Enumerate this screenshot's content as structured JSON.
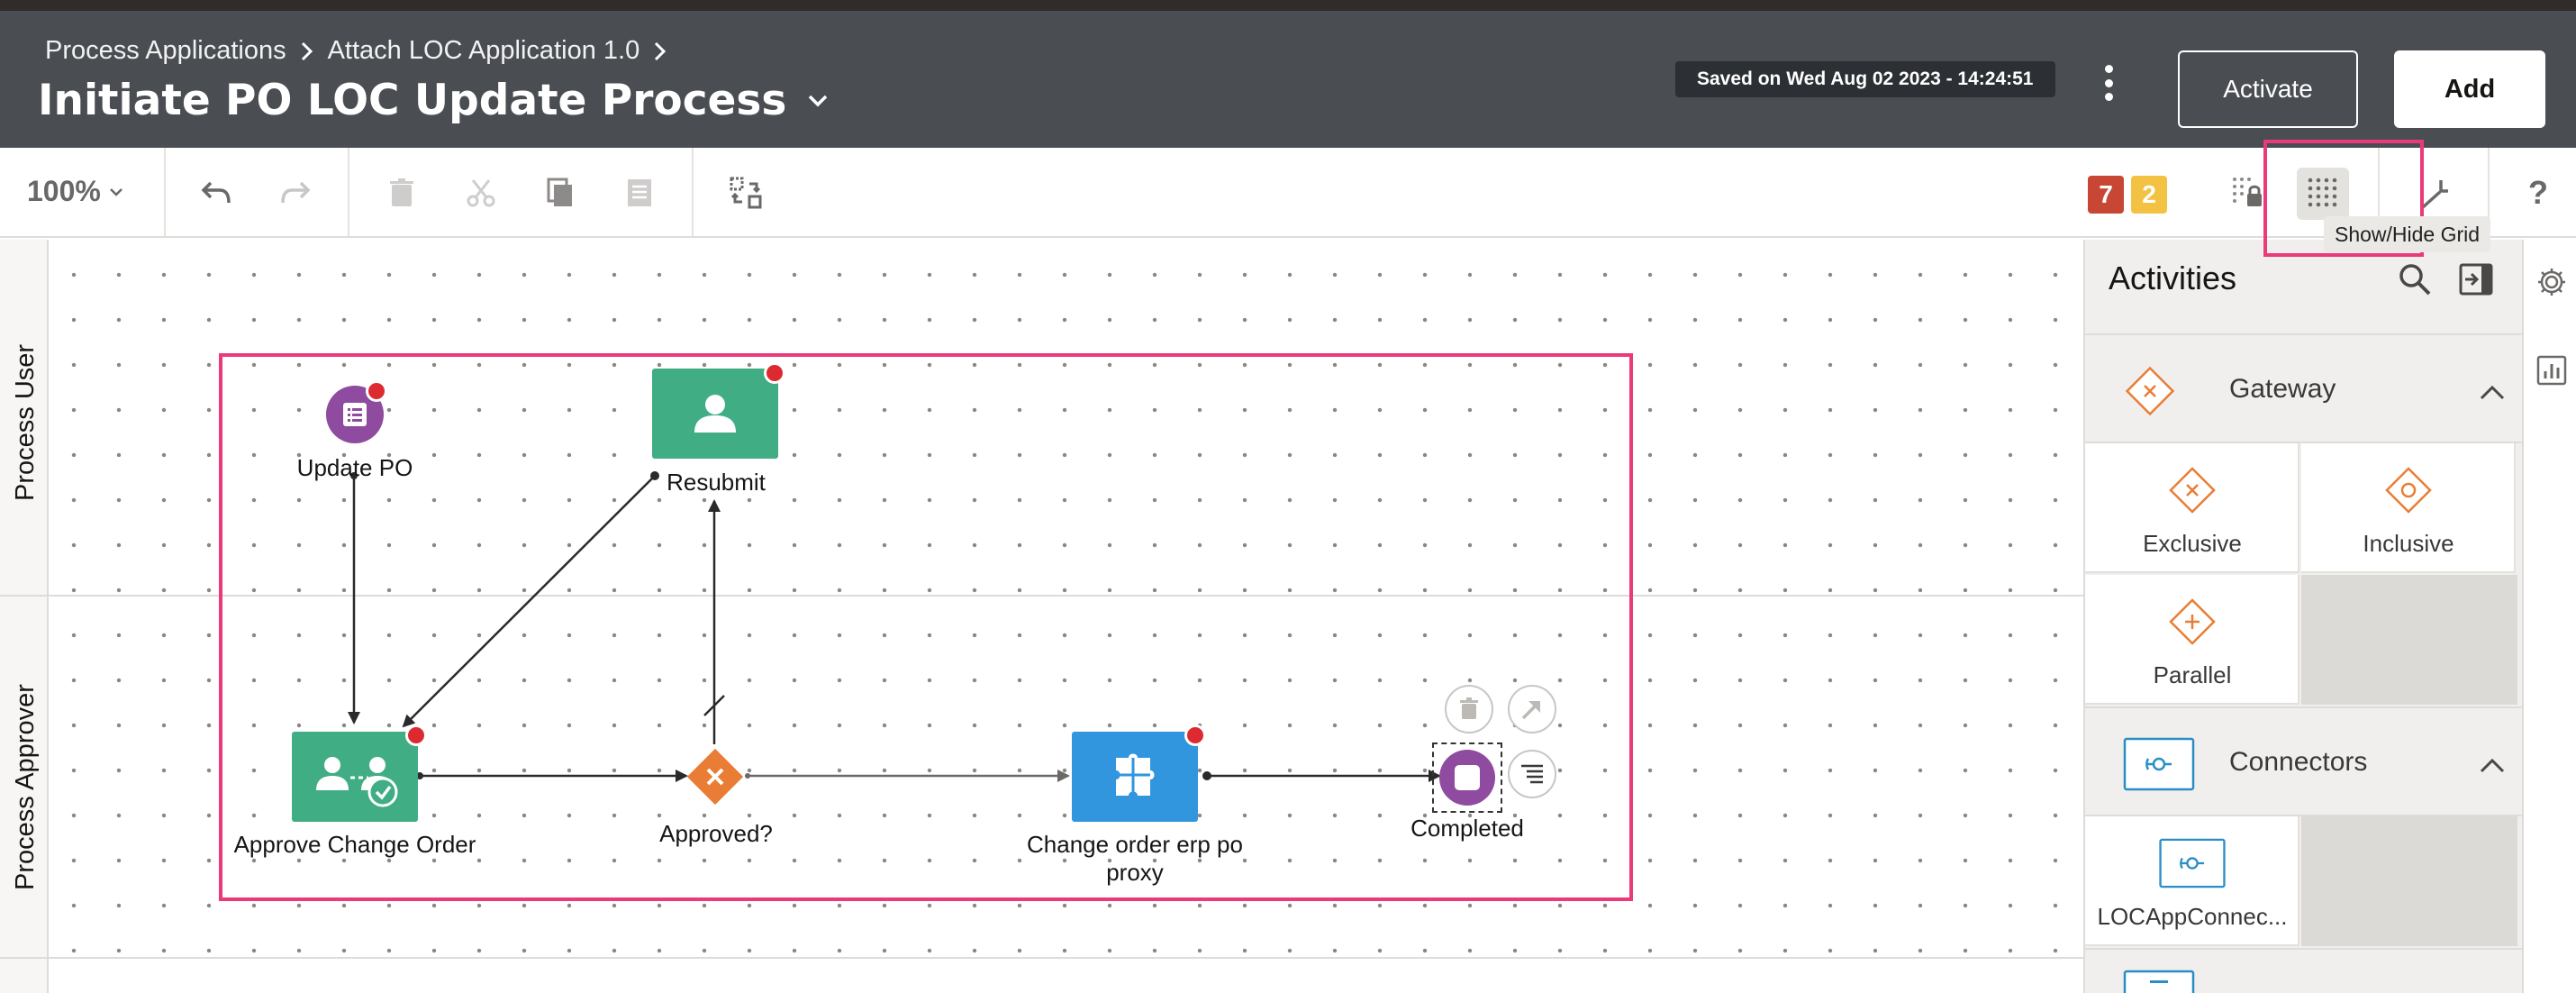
{
  "header": {
    "breadcrumb": [
      "Process Applications",
      "Attach LOC Application 1.0"
    ],
    "title": "Initiate PO LOC Update Process",
    "saved_text": "Saved on Wed Aug 02 2023 - 14:24:51",
    "activate_label": "Activate",
    "add_label": "Add"
  },
  "toolbar": {
    "zoom": "100%",
    "error_count": "7",
    "warning_count": "2",
    "tooltip": "Show/Hide Grid",
    "help_label": "?"
  },
  "lanes": [
    "Process User",
    "Process Approver"
  ],
  "nodes": {
    "update_po": "Update PO",
    "resubmit": "Resubmit",
    "approve_change_order": "Approve Change Order",
    "approved": "Approved?",
    "change_order_line1": "Change order erp po",
    "change_order_line2": "proxy",
    "completed": "Completed"
  },
  "panel": {
    "title": "Activities",
    "gateway": {
      "label": "Gateway",
      "items": [
        "Exclusive",
        "Inclusive",
        "Parallel"
      ]
    },
    "connectors": {
      "label": "Connectors",
      "items": [
        "LOCAppConnec..."
      ]
    }
  },
  "colors": {
    "header_bg": "#4a4e53",
    "task_green": "#40ad85",
    "task_blue": "#3196de",
    "event_purple": "#8e4b9f",
    "gateway_orange": "#e97d35",
    "error_red": "#dd2a30",
    "highlight_pink": "#ea3a7a",
    "connector_blue": "#2a8ec6"
  },
  "icons": [
    "chevron-right-icon",
    "chevron-down-icon",
    "kebab-icon",
    "undo-icon",
    "redo-icon",
    "trash-icon",
    "scissors-icon",
    "copy-icon",
    "paste-icon",
    "replace-icon",
    "grid-lock-icon",
    "grid-icon",
    "collapse-arrow-icon",
    "help-icon",
    "search-icon",
    "panel-collapse-icon",
    "gear-icon",
    "chart-icon",
    "user-icon",
    "list-icon",
    "puzzle-icon",
    "check-icon"
  ]
}
